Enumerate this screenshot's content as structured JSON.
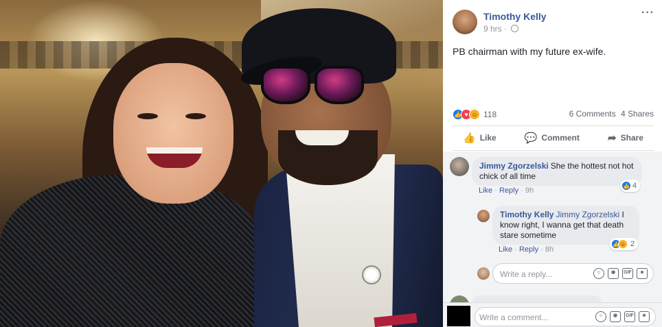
{
  "post": {
    "author": "Timothy Kelly",
    "time": "9 hrs",
    "privacy_icon": "globe-icon",
    "text": "PB chairman with my future ex-wife.",
    "reaction_count": "118",
    "comments_count": "6 Comments",
    "shares_count": "4 Shares",
    "reaction_icons": [
      "like-icon",
      "love-icon",
      "haha-icon"
    ]
  },
  "actions": {
    "like": "Like",
    "comment": "Comment",
    "share": "Share"
  },
  "comments": [
    {
      "author": "Jimmy Zgorzelski",
      "text_line1": "She the hottest not hot",
      "text_line2": "chick of all time",
      "like_label": "Like",
      "reply_label": "Reply",
      "time": "9h",
      "reaction_count": "4"
    },
    {
      "author": "Timothy Kelly",
      "mention": "Jimmy Zgorzelski",
      "text_line1": "I",
      "text_line2": "know right, I wanna get that death",
      "text_line3": "stare sometime",
      "like_label": "Like",
      "reply_label": "Reply",
      "time": "8h",
      "reaction_count": "2"
    }
  ],
  "reply_input": {
    "placeholder": "Write a reply..."
  },
  "comment_input": {
    "placeholder": "Write a comment..."
  },
  "colors": {
    "link_blue": "#385898",
    "like_blue": "#1877f2",
    "love_red": "#f33e58",
    "haha_yellow": "#f7b125",
    "comment_bg": "#f2f3f5"
  }
}
